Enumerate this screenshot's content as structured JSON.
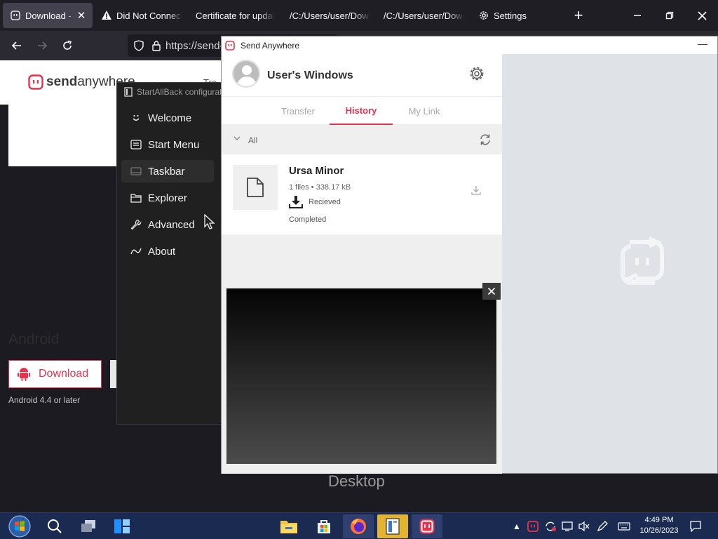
{
  "browser": {
    "tabs": [
      {
        "label": "Download - Send Anywhere",
        "icon": "send-anywhere-icon",
        "active": true
      },
      {
        "label": "Did Not Connect",
        "icon": "warning-icon"
      },
      {
        "label": "Certificate for updates",
        "icon": ""
      },
      {
        "label": "/C:/Users/user/Downloads",
        "icon": ""
      },
      {
        "label": "/C:/Users/user/Downloads",
        "icon": ""
      },
      {
        "label": "Settings",
        "icon": "gear-icon"
      }
    ],
    "new_tab_symbol": "+",
    "url": "https://send-anywhere.com"
  },
  "webpage": {
    "logo_brand": "send",
    "logo_rest": "anywhere",
    "header_peek": "Tra",
    "android_title": "Android",
    "download_label": "Download",
    "android_note": "Android 4.4 or later"
  },
  "startallback": {
    "title": "StartAllBack configuration",
    "menu": [
      {
        "label": "Welcome",
        "icon": "smile-icon"
      },
      {
        "label": "Start Menu",
        "icon": "start-menu-icon"
      },
      {
        "label": "Taskbar",
        "icon": "taskbar-icon"
      },
      {
        "label": "Explorer",
        "icon": "folder-icon"
      },
      {
        "label": "Advanced",
        "icon": "wrench-icon"
      },
      {
        "label": "About",
        "icon": "about-icon"
      }
    ]
  },
  "send_anywhere": {
    "window_title": "Send Anywhere",
    "profile_name": "User's Windows",
    "tabs": [
      "Transfer",
      "History",
      "My Link"
    ],
    "active_tab": "History",
    "filter_label": "All",
    "history": {
      "name": "Ursa Minor",
      "meta": "1 files • 338.17 kB",
      "direction": "Recieved",
      "status": "Completed"
    }
  },
  "desktop_label": "Desktop",
  "taskbar": {
    "time": "4:49 PM",
    "date": "10/26/2023"
  },
  "colors": {
    "accent": "#e8334f",
    "taskbar": "#1a2a50"
  }
}
